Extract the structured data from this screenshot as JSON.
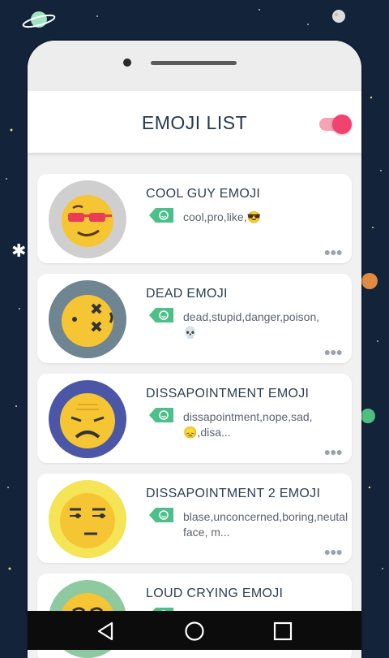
{
  "header": {
    "title": "EMOJI LIST"
  },
  "toggle": {
    "on": true
  },
  "emojis": [
    {
      "name": "COOL GUY EMOJI",
      "tags": "cool,pro,like,😎",
      "icon": "cool-guy-emoji-icon",
      "bg": "#cfcfcf"
    },
    {
      "name": "DEAD EMOJI",
      "tags": "dead,stupid,danger,poison,💀",
      "icon": "dead-emoji-icon",
      "bg": "#6f8591"
    },
    {
      "name": "DISSAPOINTMENT EMOJI",
      "tags": "dissapointment,nope,sad,😞,disa...",
      "icon": "disappointed-emoji-icon",
      "bg": "#4b57a6"
    },
    {
      "name": "DISSAPOINTMENT 2 EMOJI",
      "tags": "blase,unconcerned,boring,neutal face, m...",
      "icon": "unamused-emoji-icon",
      "bg": "#f5e455"
    },
    {
      "name": "LOUD CRYING EMOJI",
      "tags": "",
      "icon": "crying-emoji-icon",
      "bg": "#8fc9a0"
    }
  ],
  "more_label": "●●●",
  "nav": {
    "back": "back-icon",
    "home": "home-icon",
    "recents": "recents-icon"
  },
  "colors": {
    "accent": "#f0436f",
    "tag": "#4cbf8a",
    "title": "#26384c"
  }
}
